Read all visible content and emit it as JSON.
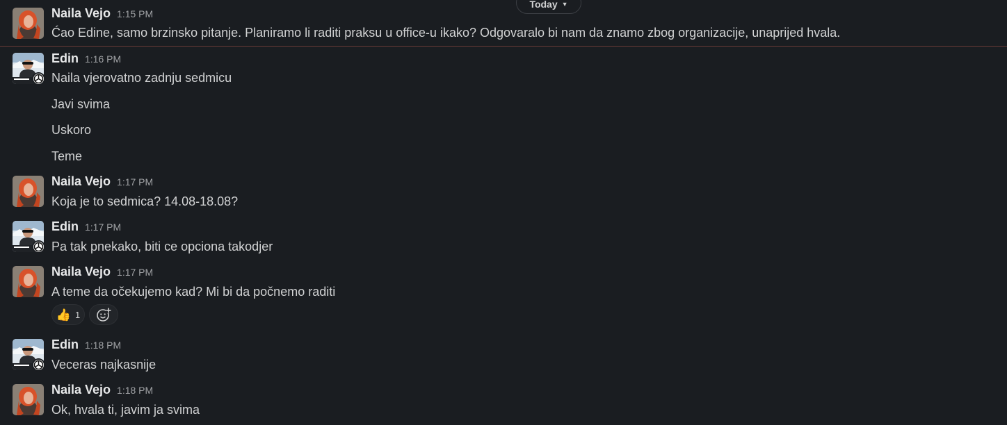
{
  "date_pill": {
    "label": "Today"
  },
  "reactions": {
    "thumbs_up": "👍",
    "thumbs_up_count": "1",
    "add_reaction_icon": "add-reaction-icon"
  },
  "messages": [
    {
      "sender": "Naila Vejo",
      "time": "1:15 PM",
      "lines": [
        "Ćao Edine, samo brzinsko pitanje. Planiramo li raditi praksu u office-u ikako? Odgovaralo bi nam da znamo zbog organizacije, unaprijed hvala."
      ]
    },
    {
      "sender": "Edin",
      "time": "1:16 PM",
      "lines": [
        "Naila vjerovatno zadnju sedmicu",
        "Javi svima",
        "Uskoro",
        "Teme"
      ]
    },
    {
      "sender": "Naila Vejo",
      "time": "1:17 PM",
      "lines": [
        "Koja je to sedmica? 14.08-18.08?"
      ]
    },
    {
      "sender": "Edin",
      "time": "1:17 PM",
      "lines": [
        "Pa tak pnekako, biti ce opciona takodjer"
      ]
    },
    {
      "sender": "Naila Vejo",
      "time": "1:17 PM",
      "lines": [
        "A teme da očekujemo kad? Mi bi da počnemo raditi"
      ]
    },
    {
      "sender": "Edin",
      "time": "1:18 PM",
      "lines": [
        "Veceras najkasnije"
      ]
    },
    {
      "sender": "Naila Vejo",
      "time": "1:18 PM",
      "lines": [
        "Ok, hvala ti, javim ja svima"
      ]
    }
  ],
  "colors": {
    "background": "#1a1d21",
    "text": "#d1d2d3",
    "name": "#e8e9ea",
    "timestamp": "#a0a2a5",
    "new_messages_line": "#6a3a38"
  }
}
